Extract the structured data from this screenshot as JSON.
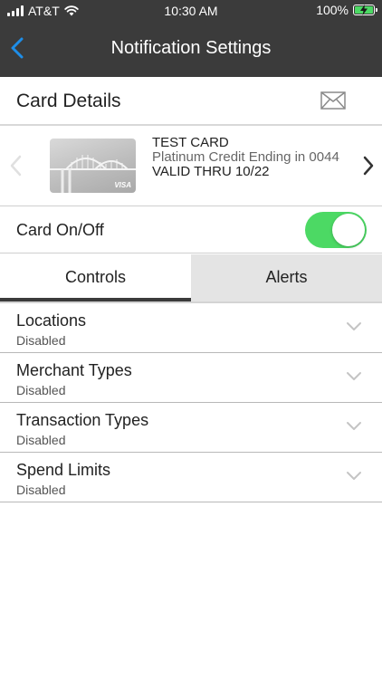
{
  "status_bar": {
    "carrier": "AT&T",
    "time": "10:30 AM",
    "battery": "100%"
  },
  "nav": {
    "title": "Notification Settings",
    "back_icon": "chevron-left-icon"
  },
  "card_details": {
    "title": "Card Details",
    "mail_icon": "envelope-icon"
  },
  "card": {
    "name": "TEST CARD",
    "description": "Platinum Credit Ending in 0044",
    "valid": "VALID THRU 10/22",
    "brand": "VISA"
  },
  "card_toggle": {
    "label": "Card On/Off",
    "state": "on"
  },
  "tabs": [
    {
      "label": "Controls",
      "selected": true
    },
    {
      "label": "Alerts",
      "selected": false
    }
  ],
  "controls": [
    {
      "title": "Locations",
      "status": "Disabled"
    },
    {
      "title": "Merchant Types",
      "status": "Disabled"
    },
    {
      "title": "Transaction Types",
      "status": "Disabled"
    },
    {
      "title": "Spend Limits",
      "status": "Disabled"
    }
  ],
  "colors": {
    "header_bg": "#3b3b3b",
    "accent_blue": "#1e8ee8",
    "toggle_on": "#4cd964",
    "inactive_tab": "#e4e4e4"
  }
}
